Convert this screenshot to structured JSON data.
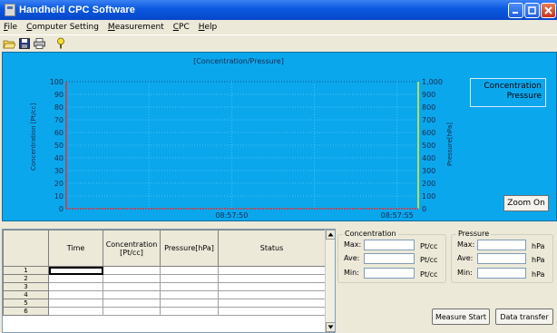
{
  "window": {
    "title": "Handheld CPC Software"
  },
  "menu": [
    {
      "ul": "F",
      "rest": "ile"
    },
    {
      "ul": "C",
      "rest": "omputer Setting"
    },
    {
      "ul": "M",
      "rest": "easurement"
    },
    {
      "ul": "C",
      "rest": "PC"
    },
    {
      "ul": "H",
      "rest": "elp"
    }
  ],
  "toolbar": [
    "open-folder-icon",
    "save-icon",
    "print-icon",
    "info-icon"
  ],
  "chart_data": {
    "type": "line",
    "title": "[Concentration/Pressure]",
    "ylabel": "Concentration [Pt/cc]",
    "y2label": "Pressure[hPa]",
    "ylim": [
      0,
      100
    ],
    "y2lim": [
      0,
      1000
    ],
    "y_ticks": [
      "0",
      "10",
      "20",
      "30",
      "40",
      "50",
      "60",
      "70",
      "80",
      "90",
      "100"
    ],
    "y2_ticks": [
      "0",
      "100",
      "200",
      "300",
      "400",
      "500",
      "600",
      "700",
      "800",
      "900",
      "1,000"
    ],
    "x_ticks": [
      "08:57:50",
      "08:57:55"
    ],
    "grid": true,
    "legend_position": "top-right",
    "series": [
      {
        "name": "Concentration",
        "color": "#e23030",
        "values": []
      },
      {
        "name": "Pressure",
        "color": "#f0f030",
        "values": []
      }
    ]
  },
  "chart": {
    "zoom_label": "Zoom On"
  },
  "table": {
    "headers": [
      "Time",
      "Concentration\n[Pt/cc]",
      "Pressure[hPa]",
      "Status"
    ],
    "row_numbers": [
      "1",
      "2",
      "3",
      "4",
      "5",
      "6"
    ]
  },
  "concentration": {
    "title": "Concentration",
    "rows": [
      {
        "label": "Max:",
        "value": "",
        "unit": "Pt/cc"
      },
      {
        "label": "Ave:",
        "value": "",
        "unit": "Pt/cc"
      },
      {
        "label": "Min:",
        "value": "",
        "unit": "Pt/cc"
      }
    ]
  },
  "pressure": {
    "title": "Pressure",
    "rows": [
      {
        "label": "Max:",
        "value": "",
        "unit": "hPa"
      },
      {
        "label": "Ave:",
        "value": "",
        "unit": "hPa"
      },
      {
        "label": "Min:",
        "value": "",
        "unit": "hPa"
      }
    ]
  },
  "buttons": {
    "measure_start": "Measure Start",
    "data_transfer": "Data transfer"
  },
  "colors": {
    "plot_bg": "#0ba7ed",
    "title_bar": "#0a58e0",
    "conc_axis": "#e23030",
    "press_axis": "#f0f030"
  }
}
